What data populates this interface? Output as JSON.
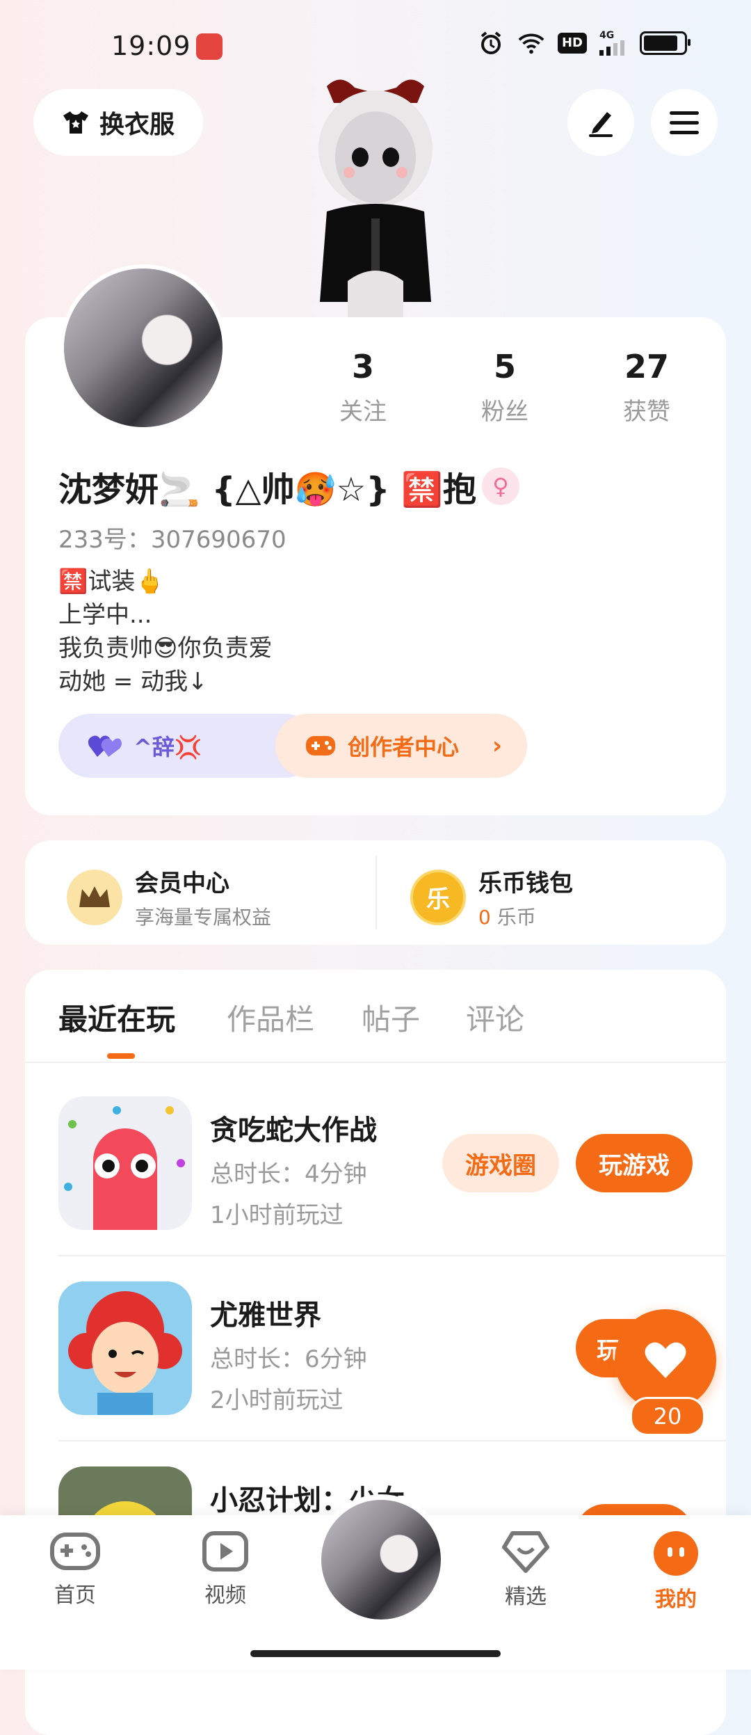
{
  "status_bar": {
    "time": "19:09",
    "network": "4G",
    "hd": "HD"
  },
  "header": {
    "outfit_label": "换衣服"
  },
  "profile": {
    "stats": [
      {
        "value": "3",
        "label": "关注"
      },
      {
        "value": "5",
        "label": "粉丝"
      },
      {
        "value": "27",
        "label": "获赞"
      }
    ],
    "name": "沈梦妍🚬 {△帅🥵☆} 🈲抱",
    "gender_icon": "♀",
    "uid": "233号：307690670",
    "bio": "🈲试装🖕\n上学中...\n我负责帅😎你负责爱\n动她 = 动我↓",
    "chips": {
      "couple": "^辞💢",
      "creator": "创作者中心"
    }
  },
  "member": {
    "vip_title": "会员中心",
    "vip_sub": "享海量专属权益",
    "wallet_title": "乐币钱包",
    "wallet_amount": "0",
    "wallet_unit": " 乐币",
    "coin_char": "乐"
  },
  "tabs": [
    "最近在玩",
    "作品栏",
    "帖子",
    "评论"
  ],
  "games": [
    {
      "title": "贪吃蛇大作战",
      "duration": "总时长：4分钟",
      "last": "1小时前玩过",
      "btn_circle": "游戏圈",
      "btn_play": "玩游戏"
    },
    {
      "title": "尤雅世界",
      "duration": "总时长：6分钟",
      "last": "2小时前玩过",
      "btn_play": "玩"
    },
    {
      "title": "小忍计划：少女"
    }
  ],
  "fab": {
    "count": "20"
  },
  "nav": {
    "home": "首页",
    "video": "视频",
    "picks": "精选",
    "mine": "我的"
  },
  "colors": {
    "accent": "#f56a14",
    "purple": "#6b5ad8"
  }
}
